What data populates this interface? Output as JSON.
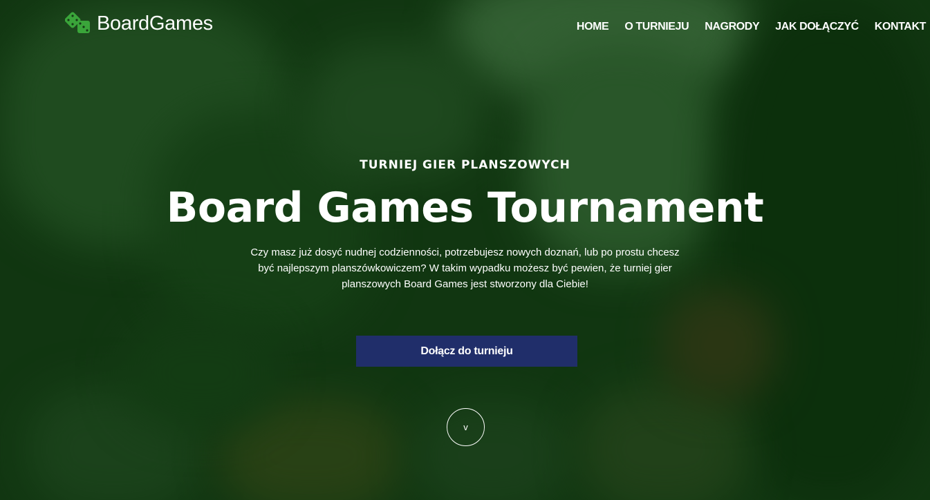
{
  "brand": {
    "name": "BoardGames",
    "icon": "dice-icon",
    "icon_color": "#3aa53a"
  },
  "nav": {
    "items": [
      {
        "label": "HOME"
      },
      {
        "label": "O TURNIEJU"
      },
      {
        "label": "NAGRODY"
      },
      {
        "label": "JAK DOŁĄCZYĆ"
      },
      {
        "label": "KONTAKT"
      }
    ]
  },
  "hero": {
    "kicker": "TURNIEJ GIER PLANSZOWYCH",
    "title": "Board Games Tournament",
    "description": "Czy masz już dosyć nudnej codzienności, potrzebujesz nowych doznań, lub po prostu chcesz być najlepszym planszówkowiczem? W takim wypadku możesz być pewien, że turniej gier planszowych Board Games jest stworzony dla Ciebie!",
    "cta_label": "Dołącz do turnieju",
    "cta_color": "#202e6a",
    "scroll_label": "v"
  }
}
